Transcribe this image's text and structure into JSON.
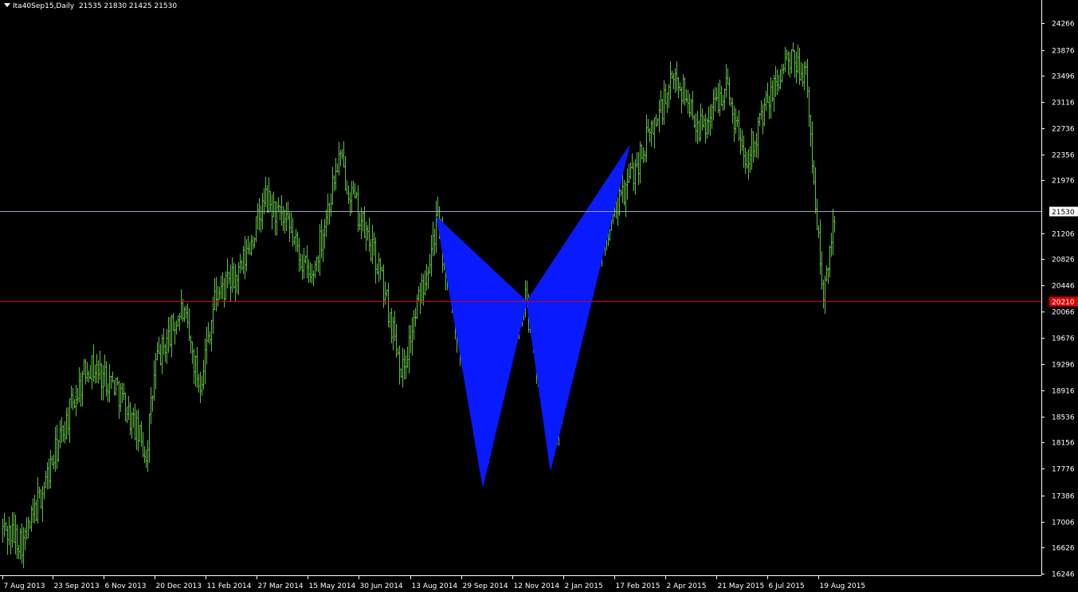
{
  "header": {
    "symbol_label": "Ita40Sep15,Daily",
    "ohlc_label": "21535 21830 21425 21530"
  },
  "colors": {
    "background": "#000000",
    "bars": "#5fbf3f",
    "pattern_fill": "#0a1aff",
    "current_price_line": "#9aa6c8",
    "level_line": "#e00000",
    "axis": "#ffffff"
  },
  "chart_data": {
    "type": "ohlc",
    "symbol": "Ita40Sep15",
    "timeframe": "Daily",
    "x_tick_labels": [
      "7 Aug 2013",
      "23 Sep 2013",
      "6 Nov 2013",
      "20 Dec 2013",
      "11 Feb 2014",
      "27 Mar 2014",
      "15 May 2014",
      "30 Jun 2014",
      "13 Aug 2014",
      "29 Sep 2014",
      "12 Nov 2014",
      "2 Jan 2015",
      "17 Feb 2015",
      "2 Apr 2015",
      "21 May 2015",
      "6 Jul 2015",
      "19 Aug 2015"
    ],
    "y_tick_labels": [
      24266,
      23876,
      23496,
      23116,
      22736,
      22356,
      21976,
      21206,
      20826,
      20446,
      20066,
      19676,
      19296,
      18916,
      18536,
      18156,
      17776,
      17386,
      17006,
      16626,
      16246
    ],
    "ylim": [
      16246,
      24266
    ],
    "close_price_waypoints": [
      {
        "date": "7 Aug 2013",
        "price": 16900
      },
      {
        "date": "Aug 2013",
        "price": 16700
      },
      {
        "date": "23 Sep 2013",
        "price": 18700
      },
      {
        "date": "Oct 2013",
        "price": 19300
      },
      {
        "date": "6 Nov 2013",
        "price": 19000
      },
      {
        "date": "Dec 2013",
        "price": 18000
      },
      {
        "date": "20 Dec 2013",
        "price": 19300
      },
      {
        "date": "Jan 2014",
        "price": 20100
      },
      {
        "date": "Jan 2014",
        "price": 19000
      },
      {
        "date": "11 Feb 2014",
        "price": 20300
      },
      {
        "date": "Mar 2014",
        "price": 20600
      },
      {
        "date": "27 Mar 2014",
        "price": 21700
      },
      {
        "date": "Apr 2014",
        "price": 21200
      },
      {
        "date": "15 May 2014",
        "price": 20500
      },
      {
        "date": "May 2014",
        "price": 22300
      },
      {
        "date": "30 Jun 2014",
        "price": 21300
      },
      {
        "date": "Jul 2014",
        "price": 20700
      },
      {
        "date": "Aug 2014",
        "price": 19200
      },
      {
        "date": "13 Aug 2014",
        "price": 21400
      },
      {
        "date": "29 Sep 2014",
        "price": 19700
      },
      {
        "date": "Oct 2014",
        "price": 17900
      },
      {
        "date": "Oct 2014",
        "price": 19600
      },
      {
        "date": "12 Nov 2014",
        "price": 20200
      },
      {
        "date": "Dec 2014",
        "price": 18000
      },
      {
        "date": "2 Jan 2015",
        "price": 19400
      },
      {
        "date": "Jan 2015",
        "price": 20600
      },
      {
        "date": "17 Feb 2015",
        "price": 22000
      },
      {
        "date": "2 Apr 2015",
        "price": 23500
      },
      {
        "date": "Apr 2015",
        "price": 22700
      },
      {
        "date": "21 May 2015",
        "price": 23400
      },
      {
        "date": "Jun 2015",
        "price": 22300
      },
      {
        "date": "6 Jul 2015",
        "price": 23700
      },
      {
        "date": "Jul 2015",
        "price": 23600
      },
      {
        "date": "19 Aug 2015",
        "price": 20200
      },
      {
        "date": "Aug 2015",
        "price": 21530
      }
    ],
    "harmonic_pattern": {
      "type": "butterfly",
      "X": {
        "date": "13 Aug 2014",
        "price": 21440
      },
      "A": {
        "date": "Oct 2014",
        "price": 17520
      },
      "B": {
        "date": "12 Nov 2014",
        "price": 20210
      },
      "C": {
        "date": "Dec 2014",
        "price": 17760
      },
      "D": {
        "date": "17 Feb 2015",
        "price": 22480
      }
    },
    "horizontal_lines": [
      {
        "name": "current-price",
        "price": 21530,
        "label": "21530"
      },
      {
        "name": "level",
        "price": 20210,
        "label": "20210"
      }
    ]
  }
}
